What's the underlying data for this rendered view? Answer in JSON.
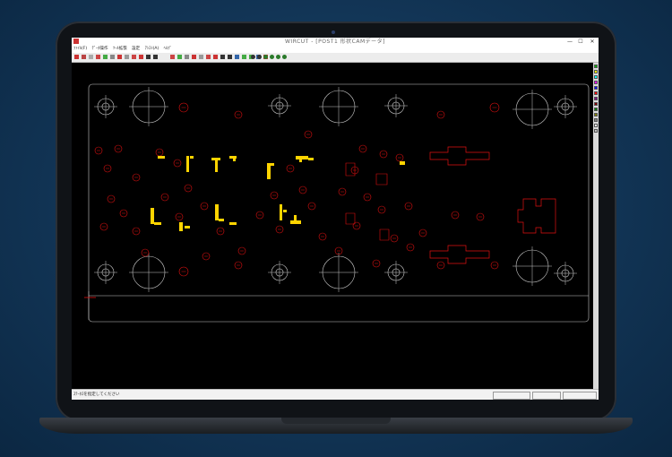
{
  "window": {
    "title": "WIRCUT - [POST1 形状CAMデータ]",
    "minimize": "—",
    "maximize": "☐",
    "close": "✕"
  },
  "menu": [
    "ﾌｧｲﾙ(F)",
    "ﾃﾞｰﾀ操作",
    "ﾂｰﾙ拡張",
    "設定",
    "ｱｼｽﾄ(A)",
    "ﾍﾙﾌﾟ"
  ],
  "status": {
    "message": "ｽﾃｰﾀｽを指定してください"
  },
  "colors": {
    "contour_red": "#e01010",
    "machine_grey": "#c8c8c8",
    "highlight_yellow": "#ffd400",
    "canvas_bg": "#000000"
  },
  "palette": [
    "#00b000",
    "#ffff00",
    "#00ffff",
    "#ff00ff",
    "#0000ff",
    "#ff0000",
    "#800080",
    "#800000",
    "#008000",
    "#808000",
    "#808080",
    "#ffffff",
    "#c0c0c0"
  ],
  "toolbar_icons": [
    "open-icon",
    "save-icon",
    "print-icon",
    "zoom-in-icon",
    "zoom-out-icon",
    "zoom-fit-icon",
    "select-icon",
    "move-icon",
    "rotate-icon",
    "mirror-icon",
    "delete-icon",
    "measure-icon"
  ]
}
